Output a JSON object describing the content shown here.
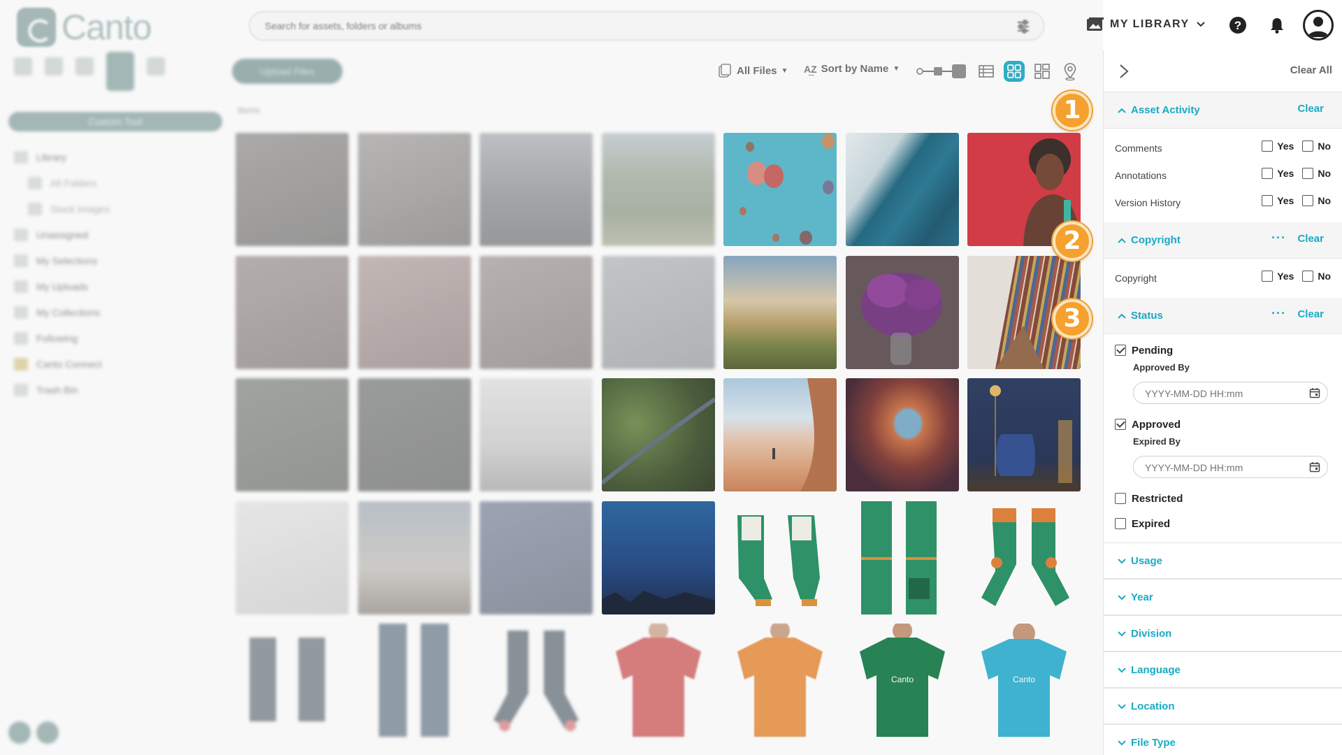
{
  "app": {
    "name": "Canto"
  },
  "search": {
    "placeholder": "Search for assets, folders or albums"
  },
  "header": {
    "library_label": "MY LIBRARY"
  },
  "icons": {
    "search_filter": "sliders-icon",
    "library": "photo-library-icon",
    "help": "help-icon",
    "notifications": "bell-icon",
    "avatar": "user-avatar-icon",
    "collapse": "chevron-right-icon"
  },
  "sidebar": {
    "custom_tool": "Custom Tool",
    "items": [
      {
        "label": "Library"
      },
      {
        "label": "All Folders",
        "sub": true
      },
      {
        "label": "Stock Images",
        "sub": true
      },
      {
        "label": "Unassigned"
      },
      {
        "label": "My Selections"
      },
      {
        "label": "My Uploads"
      },
      {
        "label": "My Collections"
      },
      {
        "label": "Following"
      },
      {
        "label": "Canto Connect"
      },
      {
        "label": "Trash Bin"
      }
    ]
  },
  "toolbar": {
    "upload_label": "Upload Files",
    "files_filter": "All Files",
    "sort_label": "Sort by Name",
    "breadcrumb": "Items"
  },
  "panel": {
    "clear_all": "Clear All",
    "asset_activity": {
      "title": "Asset Activity",
      "clear": "Clear",
      "rows": [
        {
          "label": "Comments",
          "yes": "Yes",
          "no": "No"
        },
        {
          "label": "Annotations",
          "yes": "Yes",
          "no": "No"
        },
        {
          "label": "Version History",
          "yes": "Yes",
          "no": "No"
        }
      ]
    },
    "copyright": {
      "title": "Copyright",
      "more": "···",
      "clear": "Clear",
      "rows": [
        {
          "label": "Copyright",
          "yes": "Yes",
          "no": "No"
        }
      ]
    },
    "status": {
      "title": "Status",
      "more": "···",
      "clear": "Clear",
      "pending": {
        "label": "Pending",
        "checked": true,
        "sub_label": "Approved By",
        "placeholder": "YYYY-MM-DD HH:mm"
      },
      "approved": {
        "label": "Approved",
        "checked": true,
        "sub_label": "Expired By",
        "placeholder": "YYYY-MM-DD HH:mm"
      },
      "restricted": {
        "label": "Restricted",
        "checked": false
      },
      "expired": {
        "label": "Expired",
        "checked": false
      }
    },
    "collapsed_sections": [
      "Usage",
      "Year",
      "Division",
      "Language",
      "Location",
      "File Type"
    ]
  },
  "callouts": [
    "1",
    "2",
    "3"
  ],
  "colors": {
    "accent": "#1aaac4",
    "brand": "#7f9e9c",
    "callout": "#f5a12f"
  }
}
